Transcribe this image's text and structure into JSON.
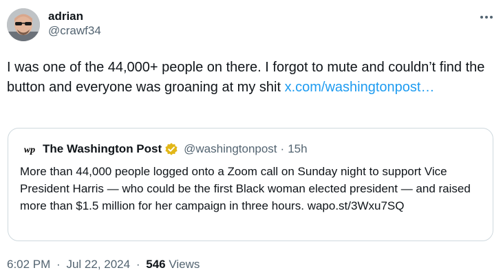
{
  "author": {
    "display_name": "adrian",
    "handle": "@crawf34",
    "avatar_icon": "avatar-photo-sunglasses"
  },
  "more_icon": "more-horizontal-icon",
  "tweet": {
    "text": "I was one of the 44,000+ people on there. I forgot to mute and couldn’t find the button and everyone was groaning at my shit ",
    "link_text": "x.com/washingtonpost…",
    "link_color": "#1d9bf0"
  },
  "quote": {
    "logo_icon": "washington-post-wp-logo",
    "display_name": "The Washington Post",
    "verified_icon": "gold-verified-badge-icon",
    "verified_color": "#e2b719",
    "handle": "@washingtonpost",
    "dot": "·",
    "time": "15h",
    "text": "More than 44,000 people logged onto a Zoom call on Sunday night to support Vice President Harris  — who could be the first Black woman elected president — and raised more than $1.5 million for her campaign in three hours.",
    "link_text": "wapo.st/3Wxu7SQ"
  },
  "footer": {
    "time": "6:02 PM",
    "separator": "·",
    "date": "Jul 22, 2024",
    "views_count": "546",
    "views_label": "Views"
  }
}
